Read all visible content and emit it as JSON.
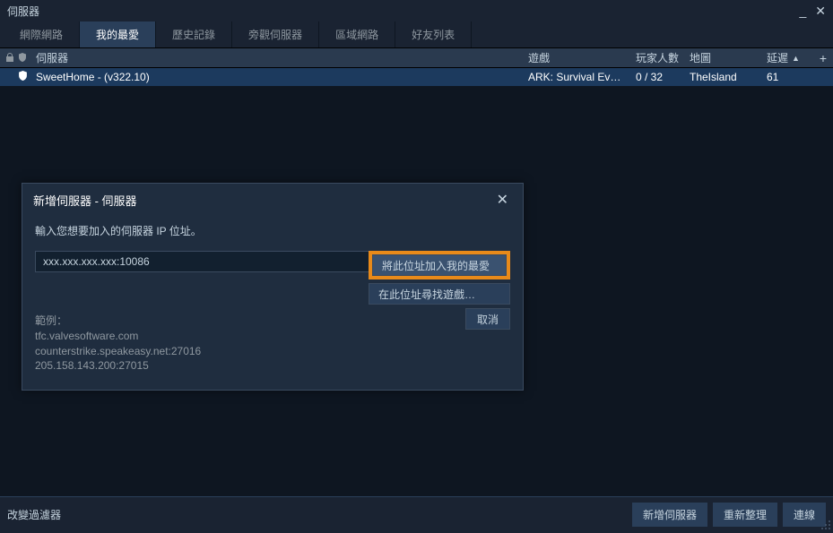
{
  "window": {
    "title": "伺服器"
  },
  "tabs": [
    "網際網路",
    "我的最愛",
    "歷史記錄",
    "旁觀伺服器",
    "區域網路",
    "好友列表"
  ],
  "activeTab": 1,
  "columns": {
    "server": "伺服器",
    "game": "遊戲",
    "players": "玩家人數",
    "map": "地圖",
    "ping": "延遲"
  },
  "rows": [
    {
      "server": "SweetHome - (v322.10)",
      "game": "ARK: Survival Evolv...",
      "players": "0 / 32",
      "map": "TheIsland",
      "ping": "61"
    }
  ],
  "footer": {
    "filter": "改變過濾器",
    "addserver": "新增伺服器",
    "refresh": "重新整理",
    "connect": "連線"
  },
  "dialog": {
    "title": "新增伺服器 - 伺服器",
    "prompt": "輸入您想要加入的伺服器 IP 位址。",
    "ip_value": "xxx.xxx.xxx.xxx:10086",
    "btn_addfav": "將此位址加入我的最愛",
    "btn_findgames": "在此位址尋找遊戲…",
    "btn_cancel": "取消",
    "example_label": "範例：",
    "example1": "tfc.valvesoftware.com",
    "example2": "counterstrike.speakeasy.net:27016",
    "example3": "205.158.143.200:27015"
  }
}
